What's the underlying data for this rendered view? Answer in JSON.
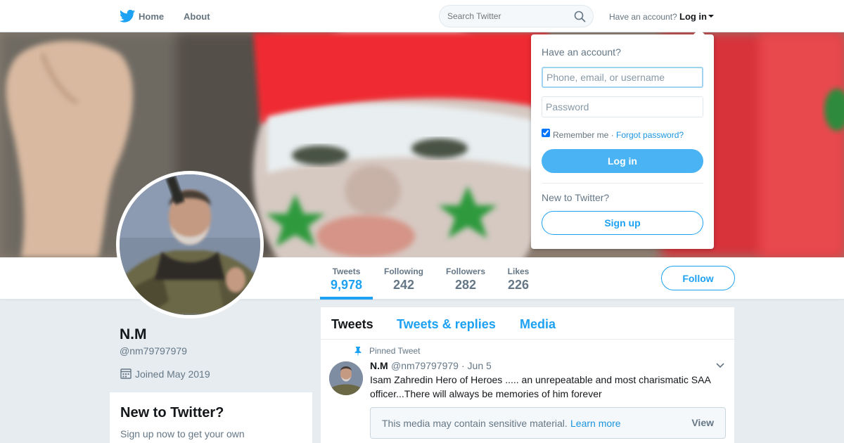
{
  "topbar": {
    "home_label": "Home",
    "about_label": "About",
    "search_placeholder": "Search Twitter",
    "have_account_label": "Have an account?",
    "login_label": "Log in"
  },
  "profile": {
    "name": "N.M",
    "handle": "@nm79797979",
    "joined": "Joined May 2019"
  },
  "stats": [
    {
      "label": "Tweets",
      "value": "9,978"
    },
    {
      "label": "Following",
      "value": "242"
    },
    {
      "label": "Followers",
      "value": "282"
    },
    {
      "label": "Likes",
      "value": "226"
    }
  ],
  "follow_label": "Follow",
  "sidebar_card": {
    "title": "New to Twitter?",
    "text": "Sign up now to get your own personalized timeline!"
  },
  "timeline": {
    "tabs": [
      "Tweets",
      "Tweets & replies",
      "Media"
    ],
    "pinned_label": "Pinned Tweet",
    "tweet": {
      "name": "N.M",
      "handle": "@nm79797979",
      "date": "· Jun 5",
      "text": "Isam Zahredin Hero of Heroes ..... an unrepeatable and most charismatic SAA officer...There will always be memories of him forever",
      "sensitive_text": "This media may contain sensitive material.",
      "learn_more": "Learn more",
      "view_label": "View"
    }
  },
  "login_dropdown": {
    "title": "Have an account?",
    "username_placeholder": "Phone, email, or username",
    "password_placeholder": "Password",
    "remember_label": "Remember me ·",
    "forgot_label": "Forgot password?",
    "login_button": "Log in",
    "new_label": "New to Twitter?",
    "signup_button": "Sign up"
  },
  "colors": {
    "accent": "#1da1f2",
    "login_button": "#4ab3f4",
    "background": "#e6ecf0"
  }
}
